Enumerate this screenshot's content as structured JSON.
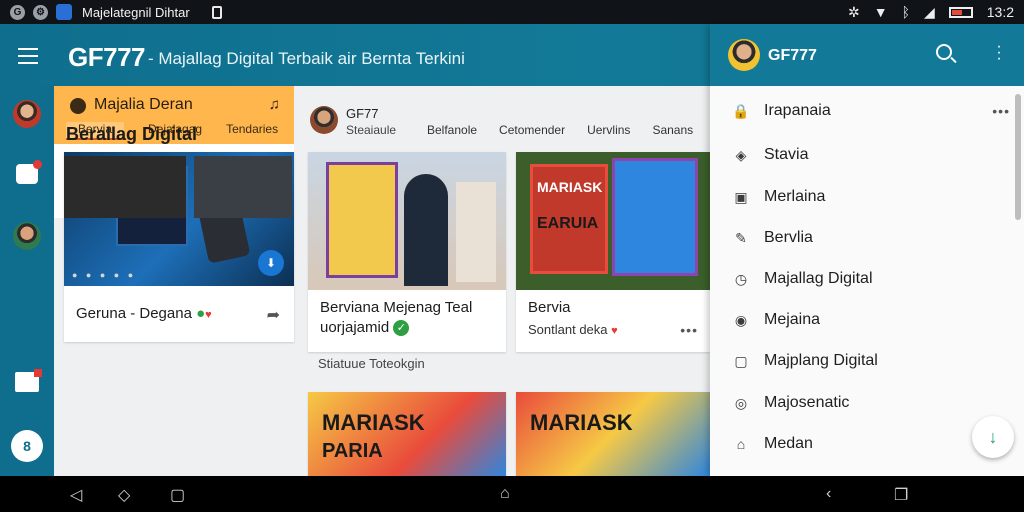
{
  "status_bar": {
    "app_title": "Majelategnil Dihtar",
    "time": "13:2",
    "icons": [
      "g-icon",
      "settings-circle-icon",
      "app-icon",
      "document-icon",
      "settings-icon",
      "wifi-icon",
      "bluetooth-icon",
      "signal-icon",
      "battery-icon"
    ]
  },
  "app_bar": {
    "brand": "GF777",
    "tagline": "- Majallag Digital Terbaik air Bernta Terkini"
  },
  "topic_card": {
    "title": "Majalia Deran",
    "tabs": [
      "Bervia",
      "Dejalagag",
      "Tendaries"
    ]
  },
  "feed_header": {
    "name": "GF77",
    "tabs": [
      "Steaiaule",
      "Belfanole",
      "Cetomender",
      "Uervlins",
      "Sanans"
    ]
  },
  "cards": {
    "c1_title": "Geruna - Degana",
    "c2_title_line1": "Berviana Mejenag Teal",
    "c2_title_line2": "uorjajamid",
    "c2_sub": "Stiatuue Toteokgin",
    "c3_title": "Bervia",
    "c3_sub": "Sontlant deka",
    "c4_title": "Berallag Digital",
    "poster_text_1": "MARIASK",
    "poster_text_2": "EARUIA",
    "poster_text_3": "MARIASK",
    "poster_text_4": "PARIA"
  },
  "drawer": {
    "title": "GF777",
    "items": [
      {
        "label": "Irapanaia",
        "icon": "lock-icon"
      },
      {
        "label": "Stavia",
        "icon": "tag-icon"
      },
      {
        "label": "Merlaina",
        "icon": "image-icon"
      },
      {
        "label": "Bervlia",
        "icon": "edit-icon"
      },
      {
        "label": "Majallag Digital",
        "icon": "clock-icon"
      },
      {
        "label": "Mejaina",
        "icon": "chat-icon"
      },
      {
        "label": "Majplang Digital",
        "icon": "square-icon"
      },
      {
        "label": "Majosenatic",
        "icon": "circle-icon"
      },
      {
        "label": "Medan",
        "icon": "building-icon"
      }
    ]
  },
  "colors": {
    "primary": "#127a98",
    "accent_orange": "#ffb74d",
    "fab_green": "#1f9e82"
  }
}
